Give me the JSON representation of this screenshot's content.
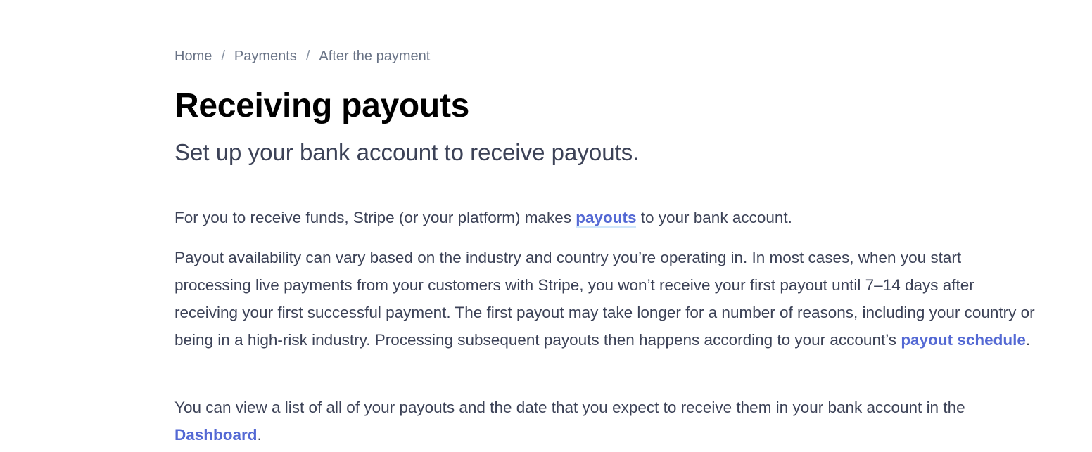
{
  "breadcrumb": {
    "items": [
      "Home",
      "Payments",
      "After the payment"
    ],
    "separator": "/"
  },
  "header": {
    "title": "Receiving payouts",
    "subtitle": "Set up your bank account to receive payouts."
  },
  "body": {
    "p1": {
      "before": "For you to receive funds, Stripe (or your platform) makes ",
      "link": "payouts",
      "after": " to your bank account."
    },
    "p2": {
      "text": "Payout availability can vary based on the industry and country you’re operating in. In most cases, when you start processing live payments from your customers with Stripe, you won’t receive your first payout until 7–14 days after receiving your first successful payment. The first payout may take longer for a number of reasons, including your country or being in a high-risk industry. Processing subsequent payouts then happens according to your account’s ",
      "link": "payout schedule",
      "after": "."
    },
    "p3": {
      "text": "You can view a list of all of your payouts and the date that you expect to receive them in your bank account in the ",
      "link": "Dashboard",
      "after": "."
    }
  },
  "colors": {
    "link": "#5469d4",
    "link_underline": "#cfe6fb",
    "title": "#000000",
    "body_text": "#3c4257",
    "breadcrumb": "#697386"
  }
}
